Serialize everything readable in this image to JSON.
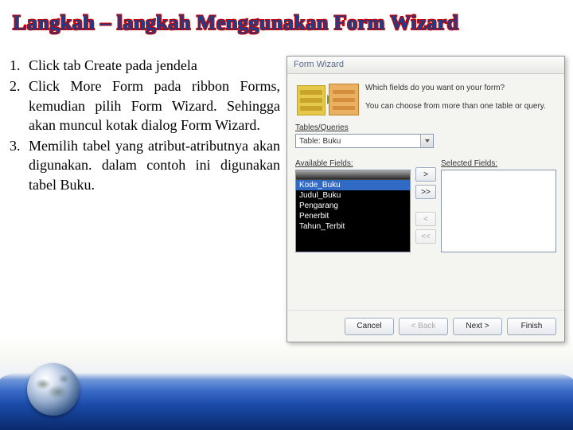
{
  "title": "Langkah – langkah Menggunakan Form Wizard",
  "steps": [
    "Click tab Create pada jendela",
    "Click More Form pada ribbon Forms, kemudian pilih Form Wizard. Sehingga akan muncul kotak dialog Form Wizard.",
    "Memilih tabel yang atribut-atributnya akan digunakan. dalam contoh ini digunakan tabel Buku."
  ],
  "dialog": {
    "title": "Form Wizard",
    "question1": "Which fields do you want on your form?",
    "question2": "You can choose from more than one table or query.",
    "tables_label": "Tables/Queries",
    "combo_value": "Table: Buku",
    "available_label": "Available Fields:",
    "selected_label": "Selected Fields:",
    "available_fields": [
      "Kode_Buku",
      "Judul_Buku",
      "Pengarang",
      "Penerbit",
      "Tahun_Terbit"
    ],
    "btn_add": ">",
    "btn_add_all": ">>",
    "btn_remove": "<",
    "btn_remove_all": "<<",
    "footer": {
      "cancel": "Cancel",
      "back": "< Back",
      "next": "Next >",
      "finish": "Finish"
    }
  }
}
